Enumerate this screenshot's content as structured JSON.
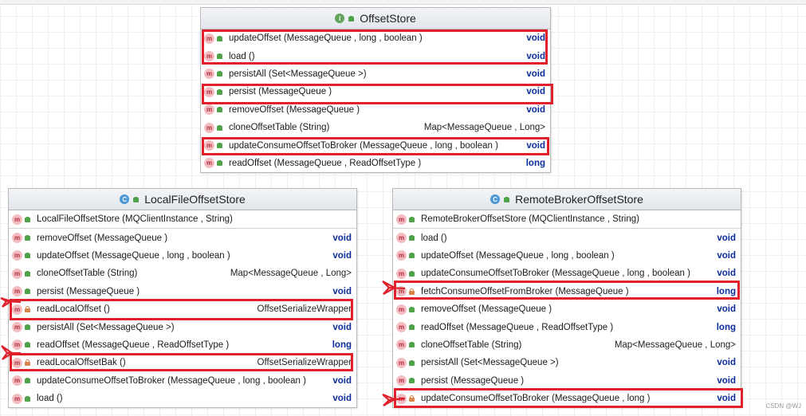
{
  "diagram": {
    "offset_store": {
      "title": "OffsetStore",
      "kind_icon": "interface-icon",
      "methods": [
        {
          "sig": "updateOffset (MessageQueue , long , boolean )",
          "ret": "void"
        },
        {
          "sig": "load ()",
          "ret": "void"
        },
        {
          "sig": "persistAll (Set<MessageQueue >)",
          "ret": "void"
        },
        {
          "sig": "persist (MessageQueue )",
          "ret": "void"
        },
        {
          "sig": "removeOffset (MessageQueue )",
          "ret": "void"
        },
        {
          "sig": "cloneOffsetTable (String)",
          "ret": "Map<MessageQueue , Long>"
        },
        {
          "sig": "updateConsumeOffsetToBroker (MessageQueue , long , boolean )",
          "ret": "void"
        },
        {
          "sig": "readOffset (MessageQueue , ReadOffsetType )",
          "ret": "long"
        }
      ]
    },
    "local_file_offset_store": {
      "title": "LocalFileOffsetStore",
      "kind_icon": "class-icon",
      "methods": [
        {
          "sig": "LocalFileOffsetStore (MQClientInstance , String)",
          "ret": ""
        },
        {
          "sig": "removeOffset (MessageQueue )",
          "ret": "void"
        },
        {
          "sig": "updateOffset (MessageQueue , long , boolean )",
          "ret": "void"
        },
        {
          "sig": "cloneOffsetTable (String)",
          "ret": "Map<MessageQueue , Long>"
        },
        {
          "sig": "persist (MessageQueue )",
          "ret": "void"
        },
        {
          "sig": "readLocalOffset ()",
          "ret": "OffsetSerializeWrapper",
          "private": true
        },
        {
          "sig": "persistAll (Set<MessageQueue >)",
          "ret": "void"
        },
        {
          "sig": "readOffset (MessageQueue , ReadOffsetType )",
          "ret": "long"
        },
        {
          "sig": "readLocalOffsetBak ()",
          "ret": "OffsetSerializeWrapper",
          "private": true
        },
        {
          "sig": "updateConsumeOffsetToBroker (MessageQueue , long , boolean )",
          "ret": "void"
        },
        {
          "sig": "load ()",
          "ret": "void"
        }
      ]
    },
    "remote_broker_offset_store": {
      "title": "RemoteBrokerOffsetStore",
      "kind_icon": "class-icon",
      "methods": [
        {
          "sig": "RemoteBrokerOffsetStore (MQClientInstance , String)",
          "ret": ""
        },
        {
          "sig": "load ()",
          "ret": "void"
        },
        {
          "sig": "updateOffset (MessageQueue , long , boolean )",
          "ret": "void"
        },
        {
          "sig": "updateConsumeOffsetToBroker (MessageQueue , long , boolean )",
          "ret": "void"
        },
        {
          "sig": "fetchConsumeOffsetFromBroker (MessageQueue )",
          "ret": "long",
          "private": true
        },
        {
          "sig": "removeOffset (MessageQueue )",
          "ret": "void"
        },
        {
          "sig": "readOffset (MessageQueue , ReadOffsetType )",
          "ret": "long"
        },
        {
          "sig": "cloneOffsetTable (String)",
          "ret": "Map<MessageQueue , Long>"
        },
        {
          "sig": "persistAll (Set<MessageQueue >)",
          "ret": "void"
        },
        {
          "sig": "persist (MessageQueue )",
          "ret": "void"
        },
        {
          "sig": "updateConsumeOffsetToBroker (MessageQueue , long )",
          "ret": "void",
          "private": true
        }
      ]
    }
  },
  "method_icon_letter": "m",
  "kind_letters": {
    "interface": "I",
    "class": "C"
  },
  "highlight_color": "#e0202a",
  "keyword_color": "#0b2d9c",
  "watermark": "CSDN @WJ"
}
